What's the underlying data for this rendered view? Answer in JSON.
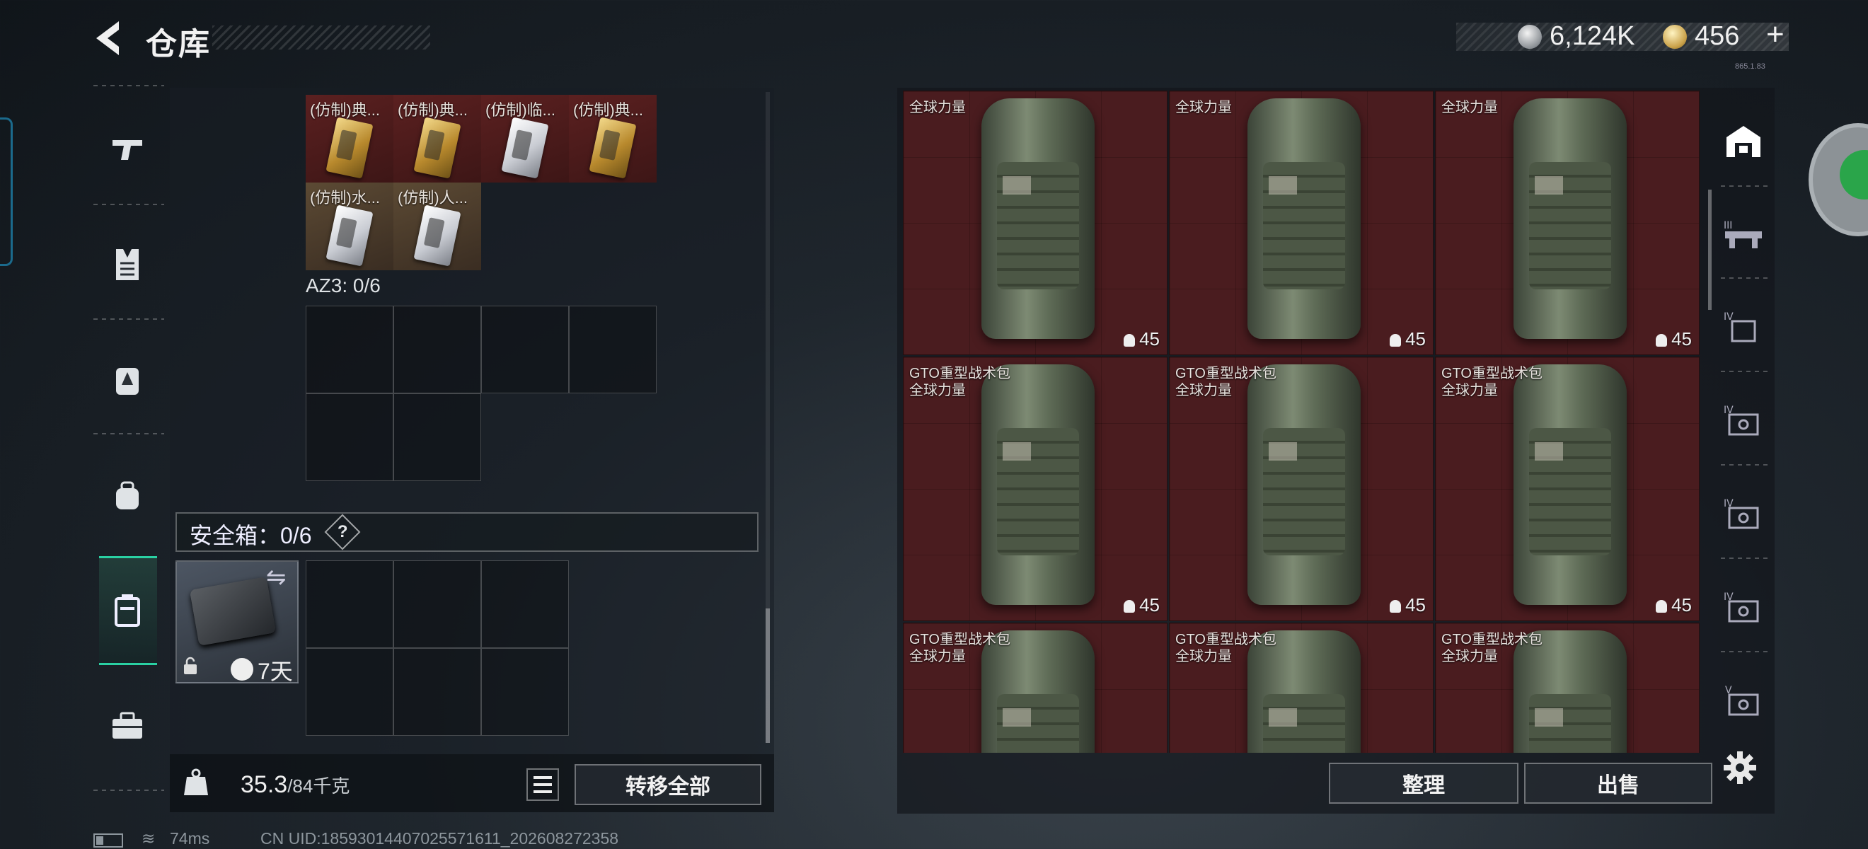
{
  "header": {
    "title": "仓库",
    "currency1": "6,124K",
    "currency2": "456",
    "plus": "+",
    "version": "865.1.83"
  },
  "left_panel": {
    "items": [
      {
        "name": "(仿制)典...",
        "card": "gold",
        "bg": "red"
      },
      {
        "name": "(仿制)典...",
        "card": "gold",
        "bg": "red"
      },
      {
        "name": "(仿制)临...",
        "card": "silver",
        "bg": "red"
      },
      {
        "name": "(仿制)典...",
        "card": "gold",
        "bg": "red"
      },
      {
        "name": "(仿制)水...",
        "card": "silver",
        "bg": "brown"
      },
      {
        "name": "(仿制)人...",
        "card": "silver",
        "bg": "brown"
      }
    ],
    "az3_label": "AZ3: 0/6",
    "safe_label": "安全箱：0/6",
    "safe_help": "?",
    "safe_days": "7天",
    "weight_current": "35.3",
    "weight_max": "/84千克",
    "transfer_all": "转移全部"
  },
  "right_panel": {
    "bags": [
      {
        "name1": "",
        "name2": "全球力量",
        "capacity": "45"
      },
      {
        "name1": "",
        "name2": "全球力量",
        "capacity": "45"
      },
      {
        "name1": "",
        "name2": "全球力量",
        "capacity": "45"
      },
      {
        "name1": "GTO重型战术包",
        "name2": "全球力量",
        "capacity": "45"
      },
      {
        "name1": "GTO重型战术包",
        "name2": "全球力量",
        "capacity": "45"
      },
      {
        "name1": "GTO重型战术包",
        "name2": "全球力量",
        "capacity": "45"
      },
      {
        "name1": "GTO重型战术包",
        "name2": "全球力量",
        "capacity": ""
      },
      {
        "name1": "GTO重型战术包",
        "name2": "全球力量",
        "capacity": ""
      },
      {
        "name1": "GTO重型战术包",
        "name2": "全球力量",
        "capacity": ""
      }
    ],
    "sort": "整理",
    "sell": "出售"
  },
  "side_tabs": [
    "III",
    "IV",
    "IV",
    "IV",
    "IV",
    "V"
  ],
  "status": {
    "ping": "74ms",
    "uid": "CN UID:18593014407025571611_202608272358"
  },
  "colors": {
    "accent": "#2ad1a3",
    "item_red": "#4a1c1f"
  }
}
